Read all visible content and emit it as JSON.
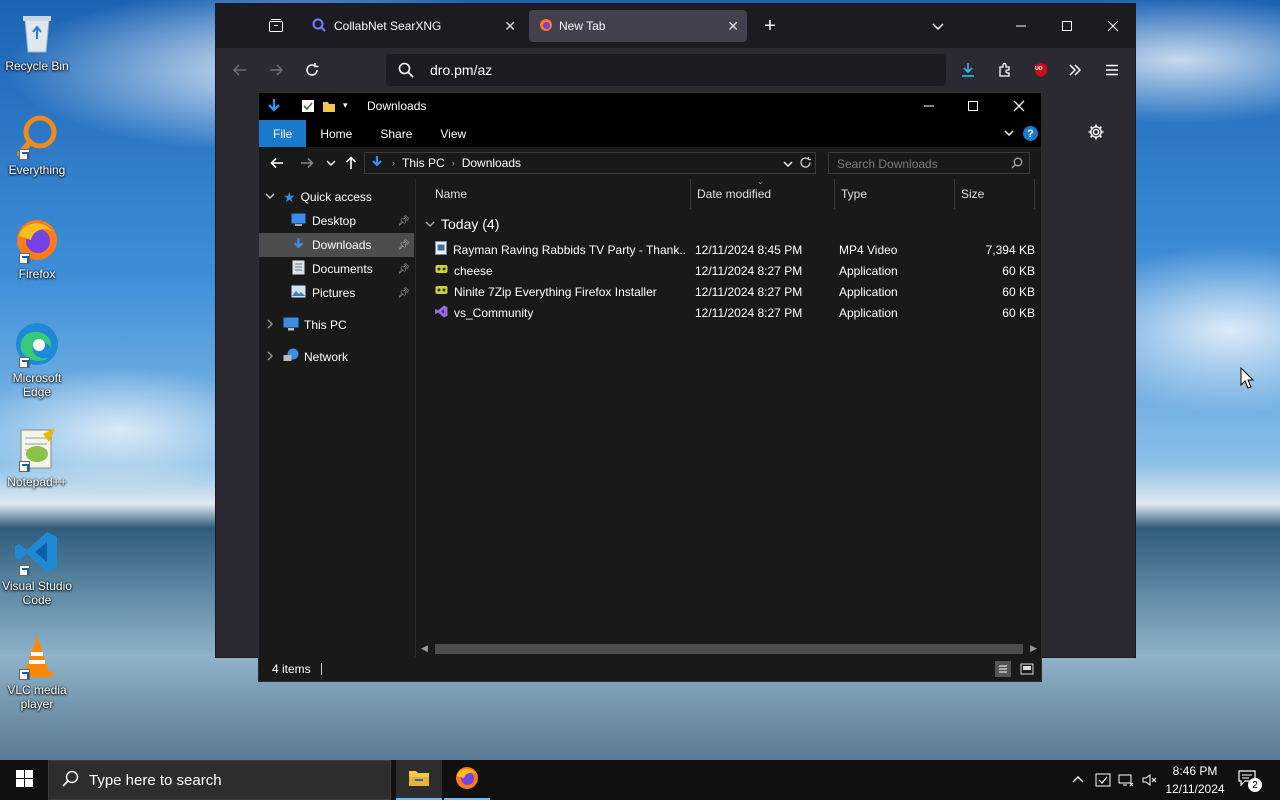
{
  "desktop": {
    "icons": [
      {
        "label": "Recycle Bin"
      },
      {
        "label": "Everything"
      },
      {
        "label": "Firefox"
      },
      {
        "label": "Microsoft Edge"
      },
      {
        "label": "Notepad++"
      },
      {
        "label": "Visual Studio Code"
      },
      {
        "label": "VLC media player"
      }
    ]
  },
  "browser": {
    "tabs": [
      {
        "label": "CollabNet SearXNG"
      },
      {
        "label": "New Tab"
      }
    ],
    "url": "dro.pm/az",
    "extension_badge": "UO"
  },
  "explorer": {
    "title": "Downloads",
    "ribbon_tabs": [
      "File",
      "Home",
      "Share",
      "View"
    ],
    "breadcrumb": [
      "This PC",
      "Downloads"
    ],
    "search_placeholder": "Search Downloads",
    "nav": {
      "quick_access": "Quick access",
      "desktop": "Desktop",
      "downloads": "Downloads",
      "documents": "Documents",
      "pictures": "Pictures",
      "this_pc": "This PC",
      "network": "Network"
    },
    "columns": {
      "name": "Name",
      "date": "Date modified",
      "type": "Type",
      "size": "Size"
    },
    "group_label": "Today (4)",
    "files": [
      {
        "name": "Rayman Raving Rabbids TV Party - Thank...",
        "date": "12/11/2024 8:45 PM",
        "type": "MP4 Video",
        "size": "7,394 KB"
      },
      {
        "name": "cheese",
        "date": "12/11/2024 8:27 PM",
        "type": "Application",
        "size": "60 KB"
      },
      {
        "name": "Ninite 7Zip Everything Firefox Installer",
        "date": "12/11/2024 8:27 PM",
        "type": "Application",
        "size": "60 KB"
      },
      {
        "name": "vs_Community",
        "date": "12/11/2024 8:27 PM",
        "type": "Application",
        "size": "60 KB"
      }
    ],
    "status": "4 items"
  },
  "taskbar": {
    "search_placeholder": "Type here to search",
    "time": "8:46 PM",
    "date": "12/11/2024",
    "notification_count": "2"
  }
}
